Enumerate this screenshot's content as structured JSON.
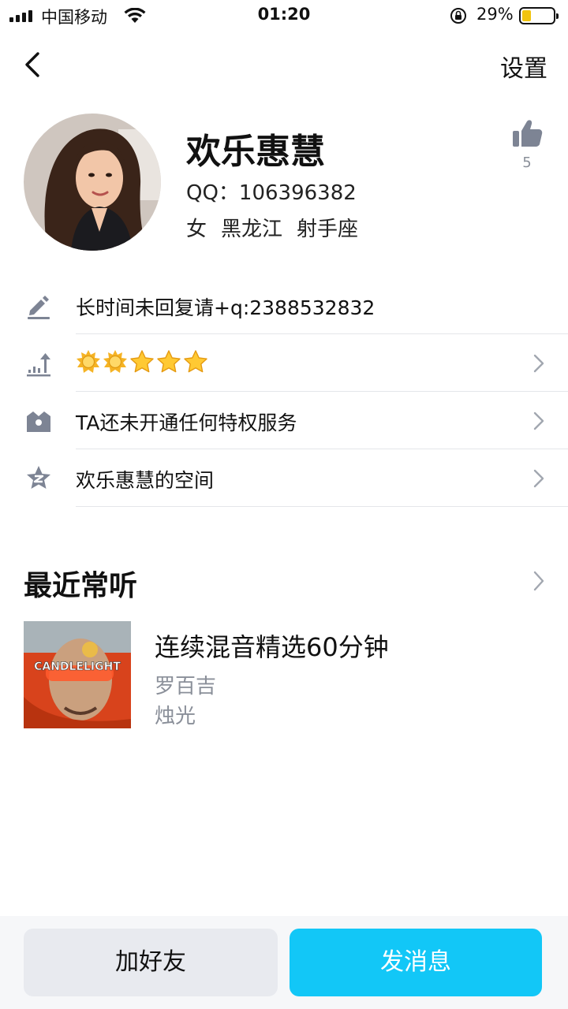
{
  "status_bar": {
    "carrier": "中国移动",
    "time": "01:20",
    "battery_percent": "29%",
    "battery_level": 0.29
  },
  "nav": {
    "back_icon": "chevron-left-icon",
    "settings_label": "设置"
  },
  "profile": {
    "name": "欢乐惠慧",
    "qq": "QQ：106396382",
    "gender": "女",
    "location": "黑龙江",
    "zodiac": "射手座",
    "like_count": "5"
  },
  "info_rows": [
    {
      "icon": "pencil-icon",
      "text": "长时间未回复请+q:2388532832",
      "has_chevron": false
    },
    {
      "icon": "level-up-icon",
      "text": "",
      "level": {
        "suns": 2,
        "stars": 3
      },
      "has_chevron": true
    },
    {
      "icon": "crown-icon",
      "text": "TA还未开通任何特权服务",
      "has_chevron": true
    },
    {
      "icon": "qzone-star-icon",
      "text": "欢乐惠慧的空间",
      "has_chevron": true
    }
  ],
  "recent": {
    "title": "最近常听",
    "song": {
      "title": "连续混音精选60分钟",
      "artist": "罗百吉",
      "album": "烛光",
      "cover_text": "CANDLELIGHT"
    }
  },
  "actions": {
    "add_friend": "加好友",
    "send_message": "发消息"
  },
  "colors": {
    "accent": "#12c7f7",
    "secondary_button": "#e8eaef",
    "icon_gray": "#7d8494",
    "muted_text": "#8a8f99",
    "divider": "#e4e6ea"
  }
}
